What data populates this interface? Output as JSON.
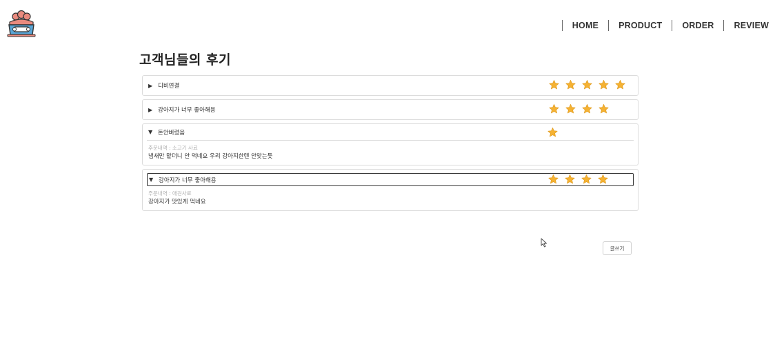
{
  "header": {
    "logo_icon": "dog-food-bowl-logo-icon",
    "nav": [
      {
        "label": "HOME"
      },
      {
        "label": "PRODUCT"
      },
      {
        "label": "ORDER"
      },
      {
        "label": "REVIEW"
      }
    ]
  },
  "page": {
    "title": "고객님들의 후기"
  },
  "colors": {
    "star": "#f5b233",
    "star_stroke": "#e09a1c",
    "border": "#dcdcdc"
  },
  "reviews": [
    {
      "title": "디비연결",
      "rating": 5,
      "expanded": false,
      "toggle": "▶"
    },
    {
      "title": "강아지가 너무 좋아해용",
      "rating": 4,
      "expanded": false,
      "toggle": "▶"
    },
    {
      "title": "돈안버렸음",
      "rating": 1,
      "expanded": true,
      "toggle": "▼",
      "order": "주문내역 : 소고기 사료",
      "content": "냄새만 맡더니 안 먹네요 우리 강아지한텐 안맞는듯"
    },
    {
      "title": "강아지가 너무 좋아해용",
      "rating": 4,
      "expanded": true,
      "toggle": "▼",
      "order": "주문내역 : 애견사료",
      "content": "강아지가 맛있게 먹네요"
    }
  ],
  "actions": {
    "write_label": "글쓰기"
  }
}
